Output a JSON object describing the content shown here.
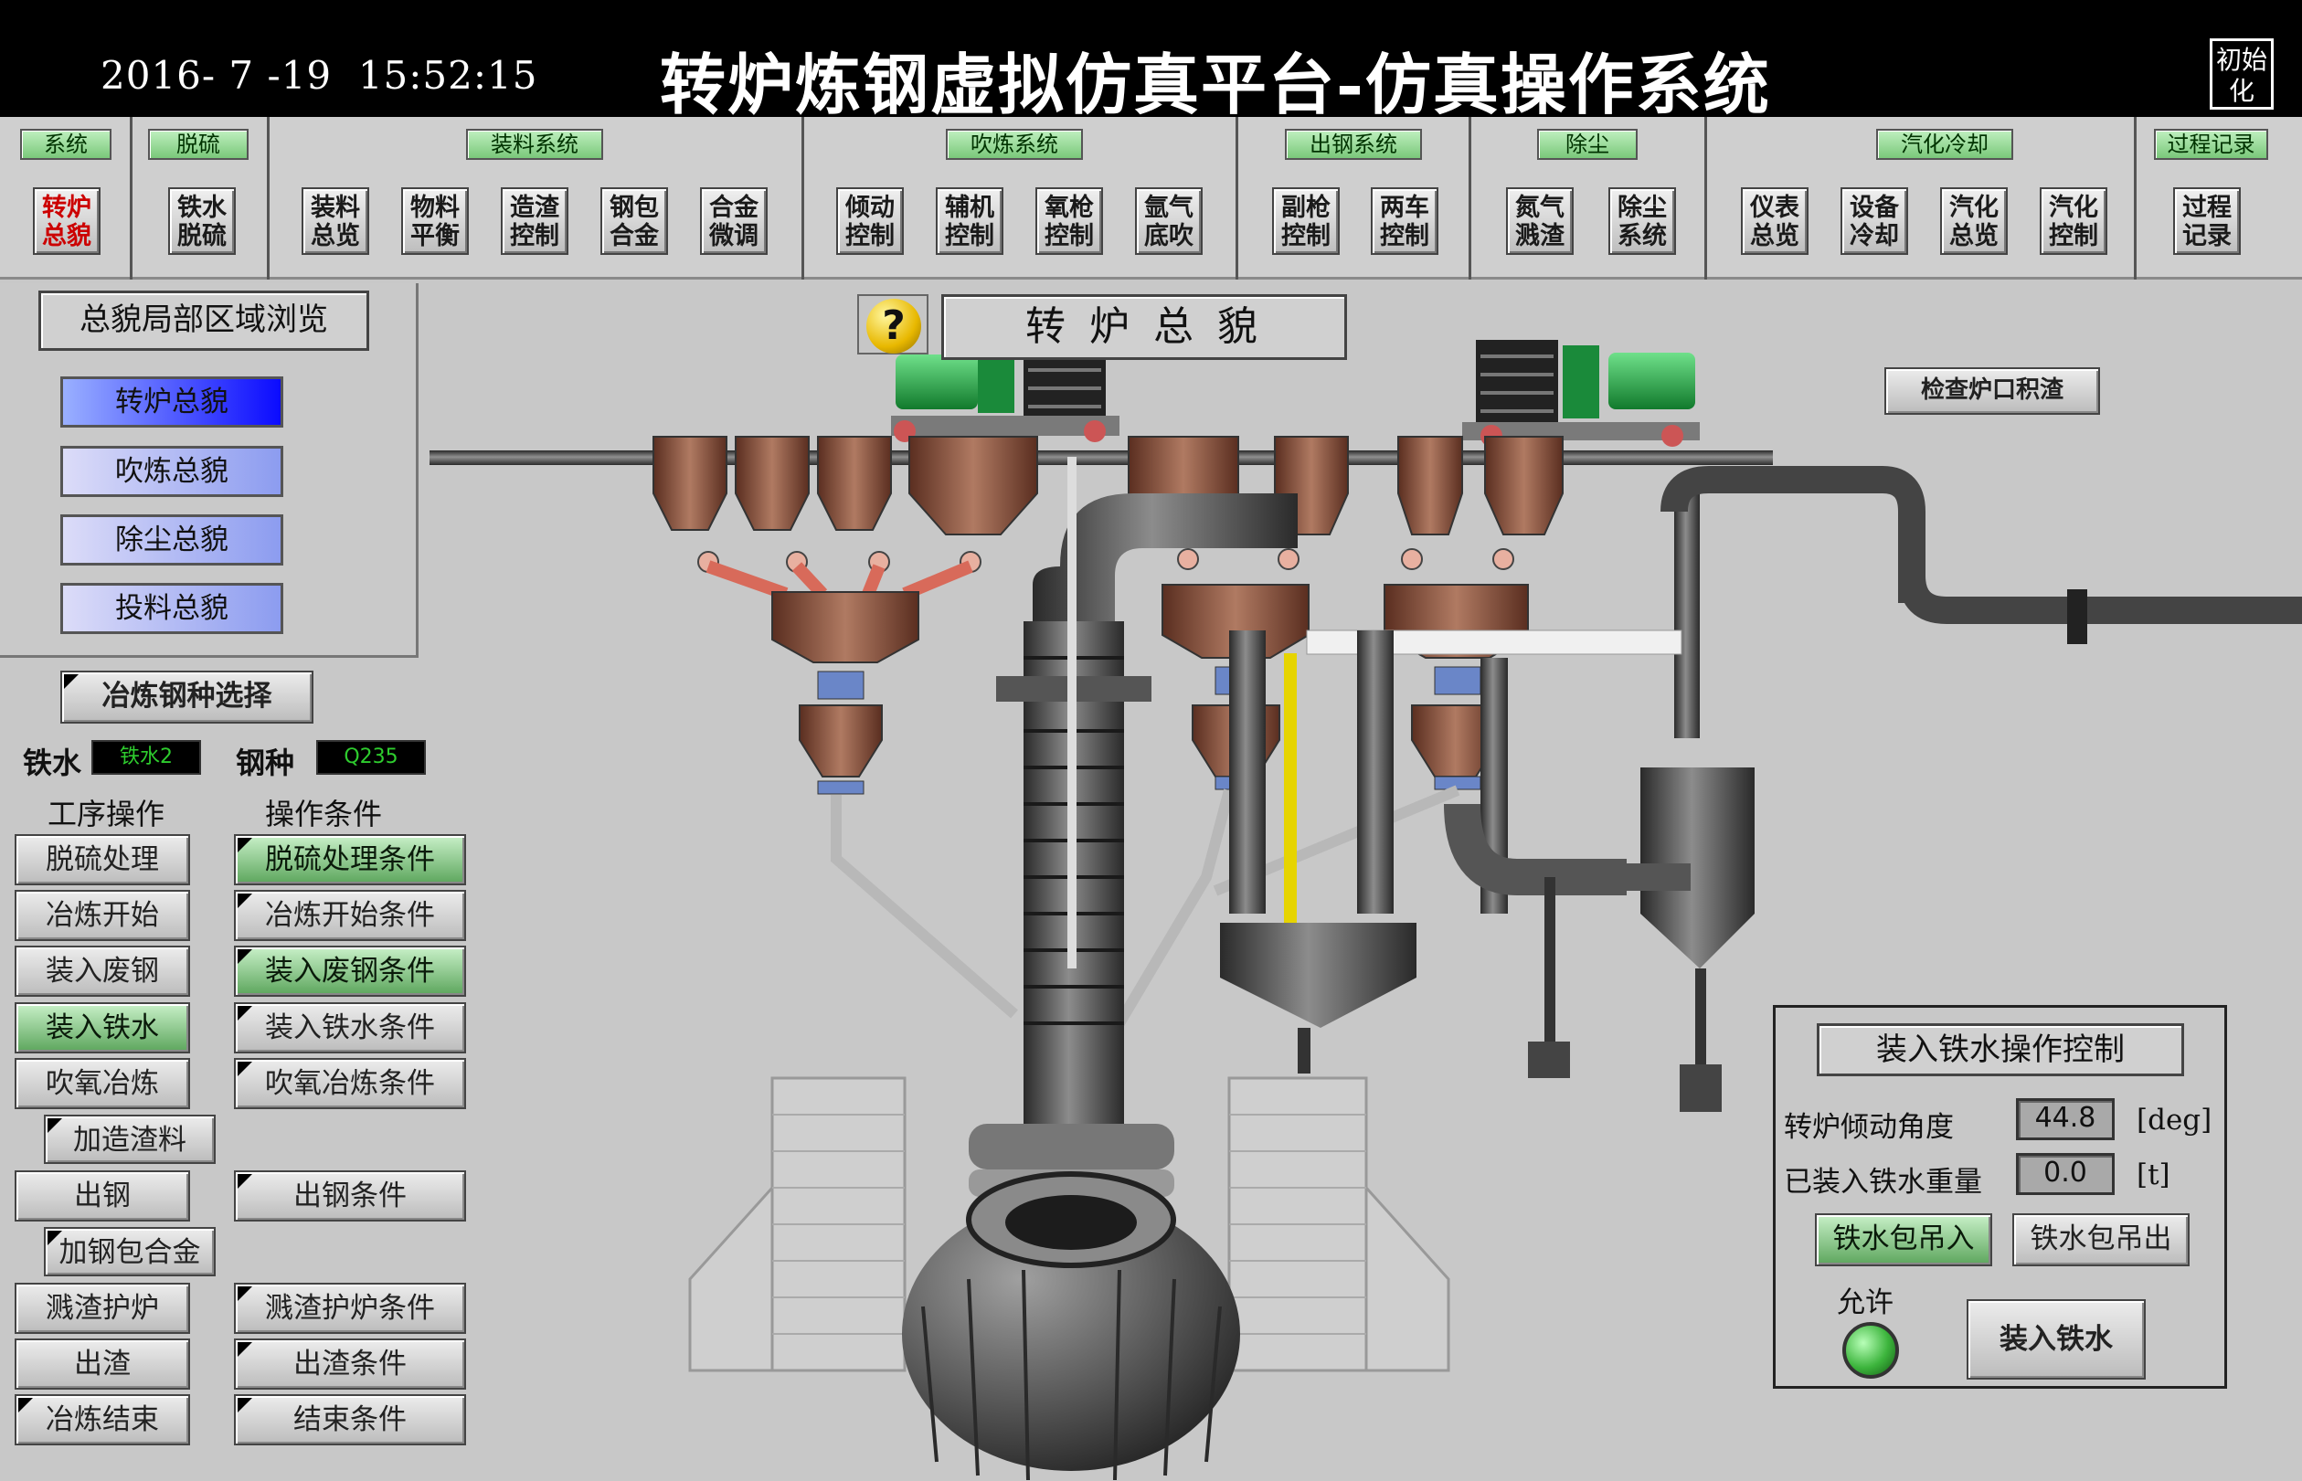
{
  "header": {
    "datetime": "2016- 7 -19  15:52:15",
    "title": "转炉炼钢虚拟仿真平台-仿真操作系统",
    "init_button": "初始化"
  },
  "menu": {
    "groups": [
      {
        "caption": "系统",
        "buttons": [
          "转炉总貌"
        ]
      },
      {
        "caption": "脱硫",
        "buttons": [
          "铁水脱硫"
        ]
      },
      {
        "caption": "装料系统",
        "buttons": [
          "装料总览",
          "物料平衡",
          "造渣控制",
          "钢包合金",
          "合金微调"
        ]
      },
      {
        "caption": "吹炼系统",
        "buttons": [
          "倾动控制",
          "辅机控制",
          "氧枪控制",
          "氩气底吹"
        ]
      },
      {
        "caption": "出钢系统",
        "buttons": [
          "副枪控制",
          "两车控制"
        ]
      },
      {
        "caption": "除尘",
        "buttons": [
          "氮气溅渣",
          "除尘系统"
        ]
      },
      {
        "caption": "汽化冷却",
        "buttons": [
          "仪表总览",
          "设备冷却",
          "汽化总览",
          "汽化控制"
        ]
      },
      {
        "caption": "过程记录",
        "buttons": [
          "过程记录"
        ]
      }
    ]
  },
  "area_browse": {
    "title": "总貌局部区域浏览",
    "items": [
      "转炉总貌",
      "吹炼总貌",
      "除尘总貌",
      "投料总貌"
    ]
  },
  "steel_select": {
    "title": "冶炼钢种选择",
    "iron_label": "铁水",
    "iron_value": "铁水2",
    "grade_label": "钢种",
    "grade_value": "Q235"
  },
  "process": {
    "ops_header": "工序操作",
    "cond_header": "操作条件",
    "ops": [
      "脱硫处理",
      "冶炼开始",
      "装入废钢",
      "装入铁水",
      "吹氧冶炼",
      "加造渣料",
      "出钢",
      "加钢包合金",
      "溅渣护炉",
      "出渣",
      "冶炼结束"
    ],
    "conds": [
      "脱硫处理条件",
      "冶炼开始条件",
      "装入废钢条件",
      "装入铁水条件",
      "吹氧冶炼条件",
      "出钢条件",
      "溅渣护炉条件",
      "出渣条件",
      "结束条件"
    ]
  },
  "scene": {
    "help_symbol": "?",
    "title": "转 炉 总 貌",
    "check_button": "检查炉口积渣"
  },
  "dialog": {
    "title": "装入铁水操作控制",
    "angle_label": "转炉倾动角度",
    "angle_value": "44.8",
    "angle_unit": "[deg]",
    "weight_label": "已装入铁水重量",
    "weight_value": "0.0",
    "weight_unit": "[t]",
    "lift_in": "铁水包吊入",
    "lift_out": "铁水包吊出",
    "permit_label": "允许",
    "charge_button": "装入铁水"
  },
  "colors": {
    "menu_caption": "#7ac87a",
    "active_nav": "#1a1aff",
    "indicator": "#3cb43c",
    "steel": "#8a4a35"
  }
}
